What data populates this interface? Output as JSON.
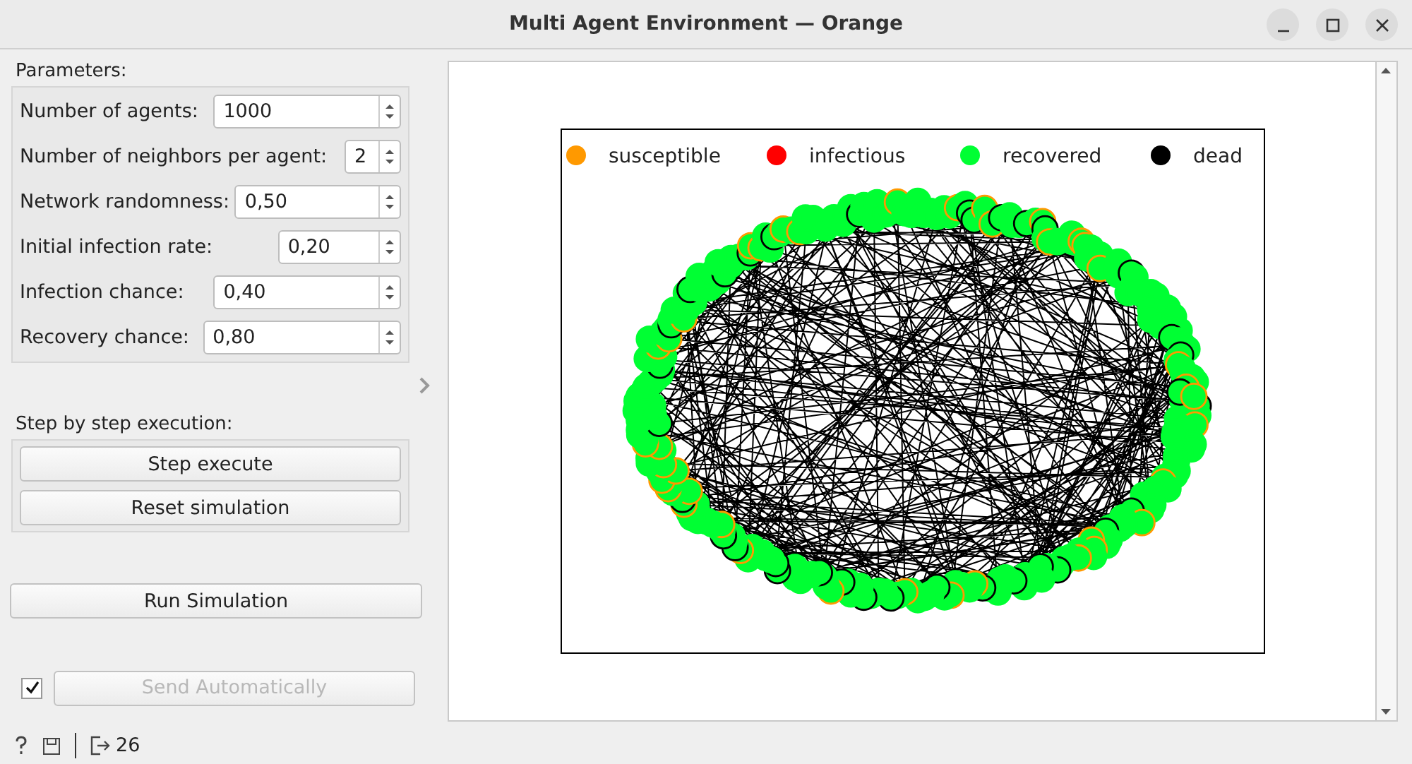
{
  "window": {
    "title": "Multi Agent Environment — Orange"
  },
  "parameters": {
    "title": "Parameters:",
    "fields": [
      {
        "label": "Number of agents:",
        "value": "1000"
      },
      {
        "label": "Number of neighbors per agent:",
        "value": "2"
      },
      {
        "label": "Network randomness:",
        "value": "0,50"
      },
      {
        "label": "Initial infection rate:",
        "value": "0,20"
      },
      {
        "label": "Infection chance:",
        "value": "0,40"
      },
      {
        "label": "Recovery chance:",
        "value": "0,80"
      }
    ]
  },
  "step": {
    "title": "Step by step execution:",
    "buttons": [
      "Step execute",
      "Reset simulation"
    ]
  },
  "run_button": "Run Simulation",
  "auto_send": {
    "checked": true,
    "label": "Send Automatically",
    "disabled": true
  },
  "status_bar": {
    "count": "26"
  },
  "legend": [
    {
      "label": "susceptible",
      "color": "#ff9900"
    },
    {
      "label": "infectious",
      "color": "#ff0000"
    },
    {
      "label": "recovered",
      "color": "#00ff33"
    },
    {
      "label": "dead",
      "color": "#000000"
    }
  ]
}
